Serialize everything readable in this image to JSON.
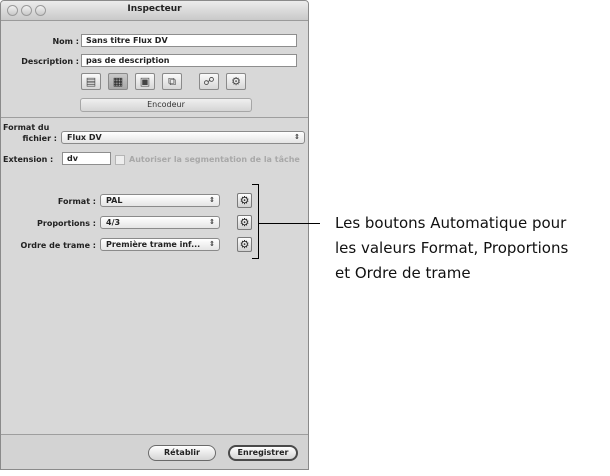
{
  "window": {
    "title": "Inspecteur"
  },
  "fields": {
    "nom_label": "Nom :",
    "nom_value": "Sans titre  Flux DV",
    "description_label": "Description :",
    "description_value": "pas de description"
  },
  "toolbar": {
    "icons": [
      "summary-icon",
      "encoder-icon",
      "filters-icon",
      "geometry-icon",
      "actions-icon",
      "settings-icon"
    ],
    "selected_index": 1,
    "pane_label": "Encodeur"
  },
  "encoder": {
    "format_fichier_label_1": "Format du",
    "format_fichier_label_2": "fichier :",
    "format_fichier_value": "Flux DV",
    "extension_label": "Extension :",
    "extension_value": "dv",
    "segmentation_label": "Autoriser la segmentation de la tâche",
    "format_label": "Format :",
    "format_value": "PAL",
    "proportions_label": "Proportions :",
    "proportions_value": "4/3",
    "ordre_label": "Ordre de trame :",
    "ordre_value": "Première trame inf..."
  },
  "buttons": {
    "retablir": "Rétablir",
    "enregistrer": "Enregistrer"
  },
  "callout": {
    "line1": "Les boutons Automatique pour",
    "line2": "les valeurs Format, Proportions",
    "line3": "et Ordre de trame"
  }
}
